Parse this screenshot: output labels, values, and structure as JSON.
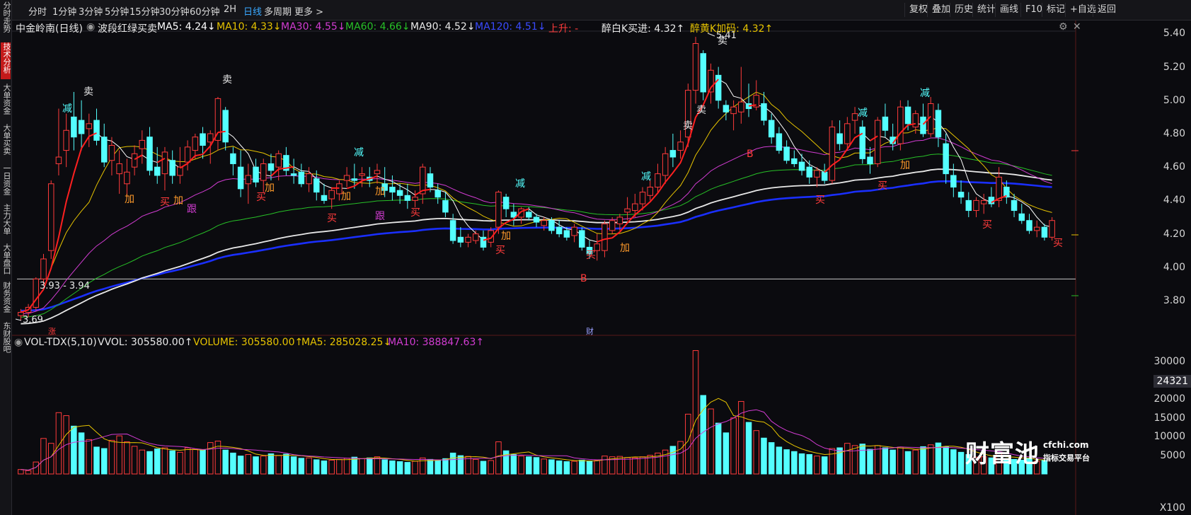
{
  "toolbar": {
    "timeframes": [
      "分时",
      "1分钟",
      "3分钟",
      "5分钟",
      "15分钟",
      "30分钟",
      "60分钟",
      "2H",
      "日线",
      "多周期",
      "更多"
    ],
    "active": "日线",
    "right_buttons": [
      "复权",
      "叠加",
      "历史",
      "统计",
      "画线",
      "F10",
      "标记",
      "+自选",
      "返回"
    ]
  },
  "sidebar": {
    "items": [
      "分时走势",
      "技术分析",
      "大单资金",
      "大单买卖",
      "一日资金",
      "主力大单",
      "大单盘口",
      "财务资金",
      "东财股吧"
    ],
    "active": "技术分析"
  },
  "main_legend": {
    "stock": "中金岭南(日线)",
    "indicator": "波段红绿买卖",
    "ma5": "MA5: 4.24↓",
    "ma10": "MA10: 4.33↓",
    "ma30": "MA30: 4.55↓",
    "ma60": "MA60: 4.66↓",
    "ma90": "MA90: 4.52↓",
    "ma120": "MA120: 4.51↓",
    "rise": "上升: -",
    "zuibai": "醉白K买进: 4.32↑",
    "zuihuang": "醉黄K加码: 4.32↑"
  },
  "vol_legend": {
    "name": "VOL-TDX(5,10)",
    "vvol": "VVOL: 305580.00↑",
    "volume": "VOLUME: 305580.00↑",
    "ma5": "MA5: 285028.25↓",
    "ma10": "MA10: 388847.63↑"
  },
  "price_axis": [
    "5.40",
    "5.20",
    "5.00",
    "4.80",
    "4.60",
    "4.40",
    "4.20",
    "4.00",
    "3.80"
  ],
  "vol_axis": [
    "30000",
    "20000",
    "15000",
    "10000",
    "5000"
  ],
  "vol_cursor": "24321",
  "vol_unit": "X100",
  "colors": {
    "up": "#ff3b3b",
    "down": "#54ffff",
    "ma5": "#ffffff",
    "ma10": "#e6c300",
    "ma30": "#d23cd2",
    "ma60": "#27c027",
    "ma90": "#e8e8e8",
    "ma120": "#1a2fff",
    "band": "#ff2020"
  },
  "watermark": {
    "brand": "财富池",
    "site": "cfchi.com",
    "tagline": "指标交易平台"
  },
  "chart_data": {
    "type": "candlestick",
    "title": "中金岭南(日线)",
    "price_ylim": [
      3.6,
      5.5
    ],
    "volume_ylim": [
      0,
      35000
    ],
    "volume_unit": "X100",
    "ohlc": [
      [
        3.71,
        3.75,
        3.68,
        3.73
      ],
      [
        3.73,
        3.78,
        3.7,
        3.76
      ],
      [
        3.76,
        3.94,
        3.74,
        3.93
      ],
      [
        3.93,
        4.08,
        3.9,
        4.05
      ],
      [
        4.1,
        4.52,
        4.05,
        4.5
      ],
      [
        4.62,
        4.95,
        4.55,
        4.66
      ],
      [
        4.7,
        4.92,
        4.6,
        4.82
      ],
      [
        4.9,
        5.05,
        4.7,
        4.78
      ],
      [
        4.88,
        5.0,
        4.7,
        4.8
      ],
      [
        4.83,
        4.92,
        4.72,
        4.86
      ],
      [
        4.88,
        4.95,
        4.73,
        4.76
      ],
      [
        4.78,
        4.86,
        4.6,
        4.63
      ],
      [
        4.64,
        4.78,
        4.55,
        4.73
      ],
      [
        4.56,
        4.7,
        4.44,
        4.62
      ],
      [
        4.5,
        4.65,
        4.42,
        4.57
      ],
      [
        4.6,
        4.73,
        4.55,
        4.68
      ],
      [
        4.71,
        4.82,
        4.62,
        4.76
      ],
      [
        4.78,
        4.84,
        4.55,
        4.58
      ],
      [
        4.6,
        4.72,
        4.5,
        4.55
      ],
      [
        4.56,
        4.72,
        4.46,
        4.69
      ],
      [
        4.64,
        4.7,
        4.5,
        4.55
      ],
      [
        4.55,
        4.72,
        4.5,
        4.6
      ],
      [
        4.63,
        4.76,
        4.58,
        4.72
      ],
      [
        4.7,
        4.8,
        4.65,
        4.78
      ],
      [
        4.8,
        4.84,
        4.65,
        4.73
      ],
      [
        4.75,
        4.82,
        4.62,
        4.8
      ],
      [
        4.76,
        5.02,
        4.7,
        5.01
      ],
      [
        4.94,
        4.96,
        4.7,
        4.75
      ],
      [
        4.68,
        4.72,
        4.55,
        4.62
      ],
      [
        4.6,
        4.7,
        4.42,
        4.47
      ],
      [
        4.5,
        4.62,
        4.38,
        4.55
      ],
      [
        4.6,
        4.65,
        4.48,
        4.51
      ],
      [
        4.52,
        4.65,
        4.45,
        4.62
      ],
      [
        4.62,
        4.68,
        4.52,
        4.58
      ],
      [
        4.6,
        4.7,
        4.52,
        4.68
      ],
      [
        4.67,
        4.72,
        4.55,
        4.58
      ],
      [
        4.56,
        4.65,
        4.5,
        4.55
      ],
      [
        4.57,
        4.62,
        4.48,
        4.5
      ],
      [
        4.5,
        4.6,
        4.45,
        4.56
      ],
      [
        4.53,
        4.58,
        4.4,
        4.45
      ],
      [
        4.43,
        4.5,
        4.38,
        4.4
      ],
      [
        4.41,
        4.48,
        4.35,
        4.46
      ],
      [
        4.44,
        4.52,
        4.4,
        4.5
      ],
      [
        4.52,
        4.6,
        4.48,
        4.55
      ],
      [
        4.53,
        4.62,
        4.47,
        4.52
      ],
      [
        4.55,
        4.6,
        4.48,
        4.56
      ],
      [
        4.54,
        4.6,
        4.48,
        4.52
      ],
      [
        4.56,
        4.62,
        4.5,
        4.58
      ],
      [
        4.5,
        4.6,
        4.42,
        4.46
      ],
      [
        4.48,
        4.55,
        4.4,
        4.45
      ],
      [
        4.46,
        4.5,
        4.38,
        4.43
      ],
      [
        4.43,
        4.5,
        4.35,
        4.4
      ],
      [
        4.4,
        4.46,
        4.36,
        4.42
      ],
      [
        4.44,
        4.62,
        4.38,
        4.6
      ],
      [
        4.56,
        4.6,
        4.45,
        4.48
      ],
      [
        4.46,
        4.5,
        4.38,
        4.42
      ],
      [
        4.4,
        4.45,
        4.3,
        4.33
      ],
      [
        4.28,
        4.32,
        4.14,
        4.16
      ],
      [
        4.18,
        4.24,
        4.12,
        4.15
      ],
      [
        4.15,
        4.2,
        4.12,
        4.18
      ],
      [
        4.16,
        4.22,
        4.14,
        4.2
      ],
      [
        4.18,
        4.22,
        4.1,
        4.12
      ],
      [
        4.15,
        4.24,
        4.12,
        4.22
      ],
      [
        4.24,
        4.46,
        4.2,
        4.45
      ],
      [
        4.42,
        4.44,
        4.3,
        4.35
      ],
      [
        4.33,
        4.38,
        4.25,
        4.3
      ],
      [
        4.3,
        4.36,
        4.26,
        4.35
      ],
      [
        4.33,
        4.36,
        4.28,
        4.3
      ],
      [
        4.3,
        4.32,
        4.24,
        4.27
      ],
      [
        4.25,
        4.3,
        4.22,
        4.28
      ],
      [
        4.28,
        4.3,
        4.2,
        4.22
      ],
      [
        4.24,
        4.28,
        4.18,
        4.2
      ],
      [
        4.22,
        4.24,
        4.16,
        4.18
      ],
      [
        4.19,
        4.26,
        4.15,
        4.24
      ],
      [
        4.22,
        4.24,
        4.1,
        4.12
      ],
      [
        4.12,
        4.16,
        4.05,
        4.08
      ],
      [
        4.1,
        4.2,
        4.04,
        4.14
      ],
      [
        4.1,
        4.28,
        4.06,
        4.26
      ],
      [
        4.22,
        4.3,
        4.2,
        4.28
      ],
      [
        4.26,
        4.32,
        4.22,
        4.3
      ],
      [
        4.33,
        4.42,
        4.28,
        4.35
      ],
      [
        4.34,
        4.44,
        4.3,
        4.38
      ],
      [
        4.38,
        4.48,
        4.34,
        4.45
      ],
      [
        4.43,
        4.52,
        4.4,
        4.48
      ],
      [
        4.48,
        4.62,
        4.44,
        4.56
      ],
      [
        4.55,
        4.72,
        4.5,
        4.68
      ],
      [
        4.7,
        4.8,
        4.6,
        4.66
      ],
      [
        4.7,
        4.82,
        4.65,
        4.75
      ],
      [
        4.78,
        5.1,
        4.72,
        5.06
      ],
      [
        5.06,
        5.38,
        4.98,
        5.34
      ],
      [
        5.28,
        5.3,
        5.0,
        5.05
      ],
      [
        5.05,
        5.22,
        4.98,
        5.18
      ],
      [
        5.15,
        5.2,
        4.95,
        5.0
      ],
      [
        4.97,
        5.0,
        4.88,
        4.93
      ],
      [
        4.92,
        5.0,
        4.82,
        4.96
      ],
      [
        4.93,
        5.2,
        4.86,
        4.99
      ],
      [
        4.98,
        5.1,
        4.9,
        4.95
      ],
      [
        4.96,
        5.12,
        4.94,
        5.03
      ],
      [
        4.98,
        5.05,
        4.85,
        4.88
      ],
      [
        4.88,
        4.92,
        4.74,
        4.78
      ],
      [
        4.8,
        4.84,
        4.68,
        4.7
      ],
      [
        4.72,
        4.76,
        4.62,
        4.64
      ],
      [
        4.65,
        4.7,
        4.6,
        4.62
      ],
      [
        4.63,
        4.68,
        4.55,
        4.58
      ],
      [
        4.6,
        4.64,
        4.5,
        4.54
      ],
      [
        4.54,
        4.6,
        4.48,
        4.58
      ],
      [
        4.57,
        4.62,
        4.5,
        4.52
      ],
      [
        4.52,
        4.88,
        4.5,
        4.84
      ],
      [
        4.8,
        4.88,
        4.7,
        4.74
      ],
      [
        4.74,
        4.9,
        4.7,
        4.86
      ],
      [
        4.88,
        4.96,
        4.8,
        4.92
      ],
      [
        4.84,
        4.88,
        4.62,
        4.65
      ],
      [
        4.66,
        4.72,
        4.56,
        4.62
      ],
      [
        4.62,
        4.9,
        4.6,
        4.88
      ],
      [
        4.9,
        4.98,
        4.78,
        4.82
      ],
      [
        4.78,
        4.86,
        4.7,
        4.74
      ],
      [
        4.74,
        5.0,
        4.7,
        4.96
      ],
      [
        4.96,
        5.0,
        4.82,
        4.86
      ],
      [
        4.84,
        4.94,
        4.8,
        4.92
      ],
      [
        4.9,
        4.98,
        4.78,
        4.8
      ],
      [
        4.8,
        5.02,
        4.78,
        4.98
      ],
      [
        4.94,
        4.98,
        4.72,
        4.78
      ],
      [
        4.74,
        4.8,
        4.5,
        4.56
      ],
      [
        4.55,
        4.62,
        4.42,
        4.48
      ],
      [
        4.45,
        4.52,
        4.38,
        4.42
      ],
      [
        4.4,
        4.45,
        4.3,
        4.34
      ],
      [
        4.34,
        4.42,
        4.3,
        4.4
      ],
      [
        4.38,
        4.44,
        4.32,
        4.4
      ],
      [
        4.42,
        4.48,
        4.36,
        4.38
      ],
      [
        4.4,
        4.6,
        4.36,
        4.54
      ],
      [
        4.48,
        4.52,
        4.38,
        4.42
      ],
      [
        4.4,
        4.44,
        4.3,
        4.34
      ],
      [
        4.32,
        4.38,
        4.26,
        4.28
      ],
      [
        4.28,
        4.32,
        4.2,
        4.22
      ],
      [
        4.22,
        4.28,
        4.18,
        4.24
      ],
      [
        4.24,
        4.26,
        4.16,
        4.18
      ],
      [
        4.18,
        4.3,
        4.16,
        4.28
      ]
    ],
    "volume": [
      1200,
      900,
      3200,
      9500,
      8200,
      16400,
      15600,
      12800,
      11000,
      9200,
      7200,
      6800,
      9000,
      10200,
      8600,
      7400,
      6400,
      6000,
      6700,
      7000,
      6200,
      5800,
      7000,
      6600,
      6400,
      8400,
      8800,
      6400,
      5600,
      4800,
      5200,
      4600,
      4800,
      5400,
      4900,
      5300,
      4600,
      4200,
      4300,
      3800,
      3500,
      3700,
      3900,
      4200,
      4500,
      4100,
      4300,
      4600,
      3800,
      3500,
      3300,
      3100,
      3400,
      4300,
      3900,
      3600,
      4100,
      5600,
      4900,
      4700,
      3900,
      3400,
      3600,
      8600,
      6200,
      5200,
      4800,
      4600,
      4400,
      4000,
      3800,
      3500,
      3300,
      3400,
      3700,
      3500,
      3600,
      4800,
      4600,
      4700,
      4400,
      4300,
      4600,
      5000,
      5600,
      6400,
      7400,
      8700,
      16000,
      33000,
      21000,
      17400,
      13600,
      11000,
      15000,
      19400,
      13800,
      11600,
      9600,
      8400,
      7200,
      6500,
      6000,
      5400,
      5200,
      4800,
      4600,
      6800,
      7000,
      8200,
      7600,
      8000,
      6600,
      7600,
      7000,
      6400,
      7200,
      6000,
      6400,
      7300,
      7800,
      8300,
      7300,
      6500,
      5800,
      5200,
      4500,
      4600,
      4300,
      5500,
      4100,
      3900,
      3700,
      4200,
      3400,
      3600
    ],
    "ma_current": {
      "MA5": 4.24,
      "MA10": 4.33,
      "MA30": 4.55,
      "MA60": 4.66,
      "MA90": 4.52,
      "MA120": 4.51
    },
    "horizontal_line": 3.93,
    "annotations": [
      {
        "text": "3.93 - 3.94",
        "price": 3.93
      },
      {
        "text": "3.69",
        "price": 3.69
      },
      {
        "text": "5.41",
        "price": 5.41
      },
      {
        "text": "涨"
      },
      {
        "text": "财"
      },
      {
        "text": "卖"
      },
      {
        "text": "卖"
      },
      {
        "text": "卖"
      },
      {
        "text": "卖"
      },
      {
        "text": "卖"
      },
      {
        "text": "买"
      },
      {
        "text": "买"
      },
      {
        "text": "买"
      },
      {
        "text": "买"
      },
      {
        "text": "买"
      },
      {
        "text": "买"
      },
      {
        "text": "买"
      },
      {
        "text": "买"
      },
      {
        "text": "买"
      },
      {
        "text": "买"
      },
      {
        "text": "加"
      },
      {
        "text": "加"
      },
      {
        "text": "加"
      },
      {
        "text": "加"
      },
      {
        "text": "加"
      },
      {
        "text": "加"
      },
      {
        "text": "加"
      },
      {
        "text": "加"
      },
      {
        "text": "减"
      },
      {
        "text": "减"
      },
      {
        "text": "减"
      },
      {
        "text": "减"
      },
      {
        "text": "减"
      },
      {
        "text": "减"
      },
      {
        "text": "跟"
      },
      {
        "text": "跟"
      },
      {
        "text": "B"
      },
      {
        "text": "B"
      }
    ]
  }
}
